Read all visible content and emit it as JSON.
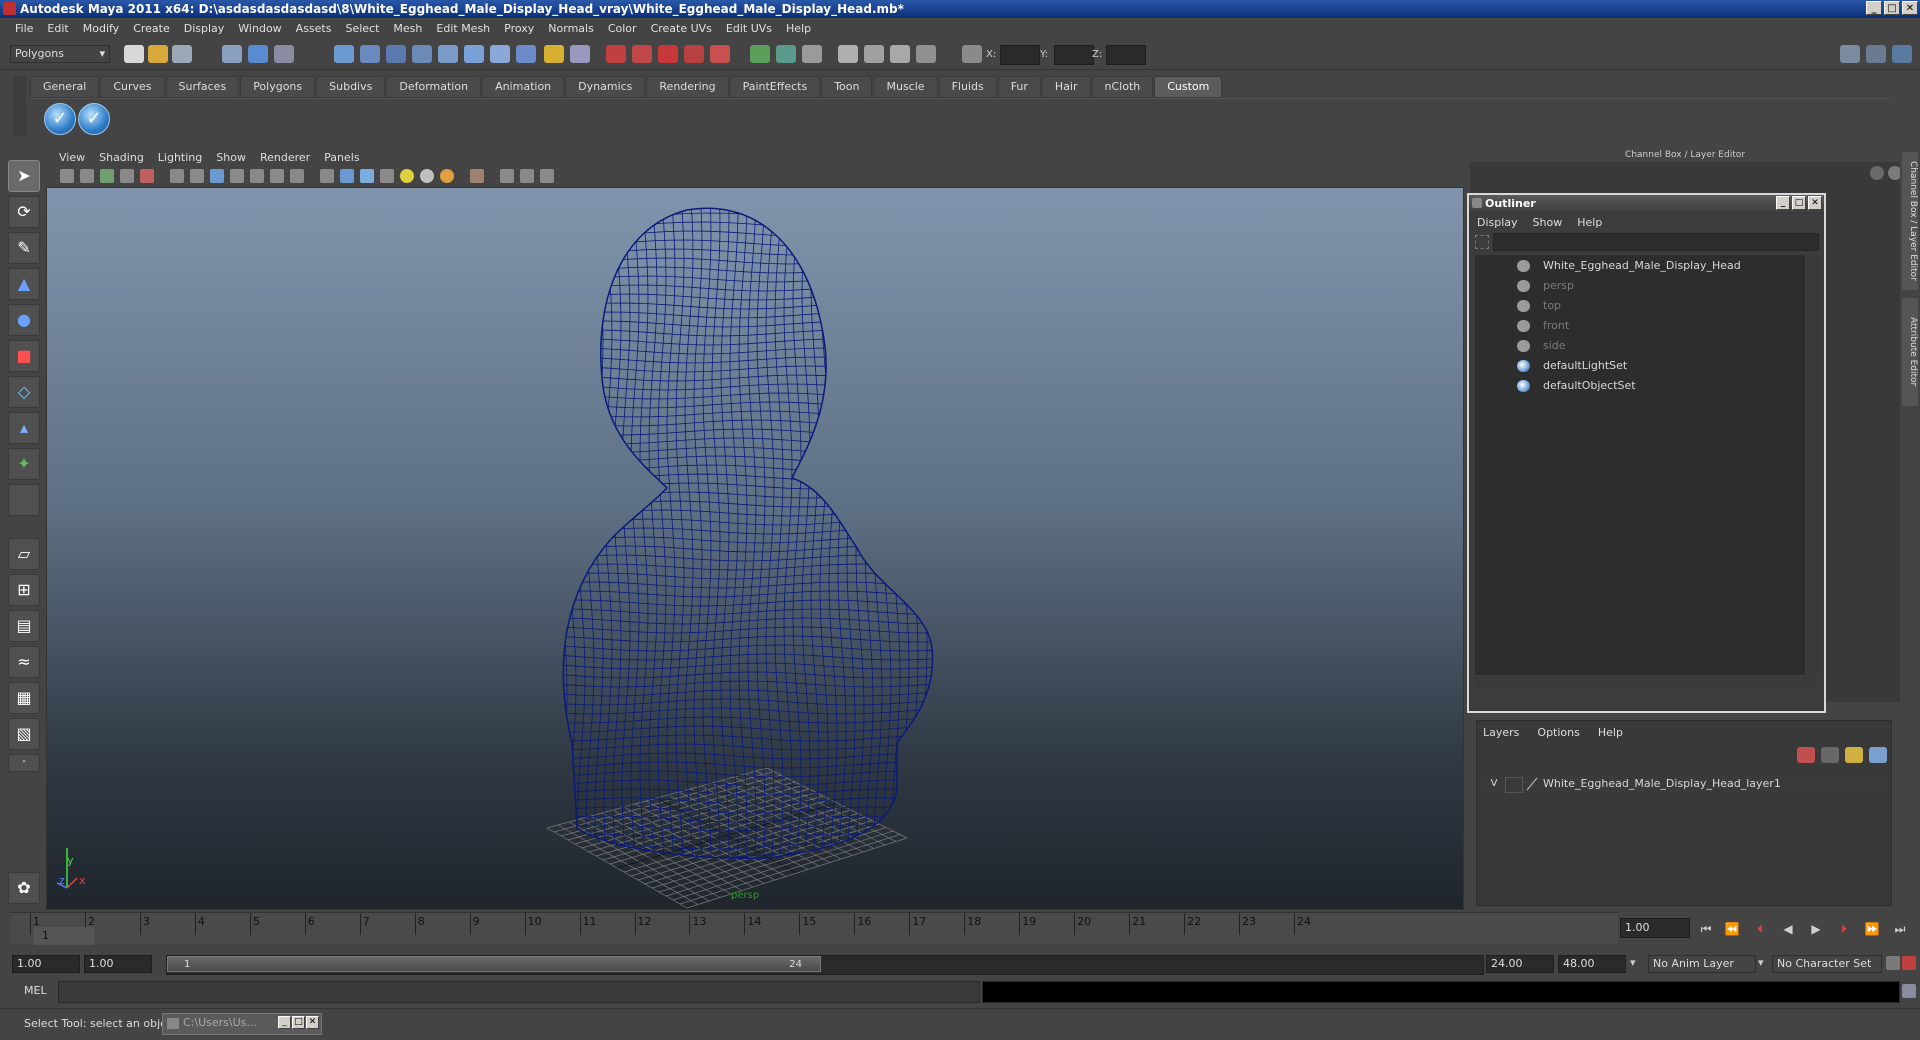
{
  "window": {
    "title": "Autodesk Maya 2011 x64: D:\\asdasdasdasdasd\\8\\White_Egghead_Male_Display_Head_vray\\White_Egghead_Male_Display_Head.mb*",
    "min": "_",
    "max": "□",
    "close": "✕"
  },
  "menubar": [
    "File",
    "Edit",
    "Modify",
    "Create",
    "Display",
    "Window",
    "Assets",
    "Select",
    "Mesh",
    "Edit Mesh",
    "Proxy",
    "Normals",
    "Color",
    "Create UVs",
    "Edit UVs",
    "Help"
  ],
  "statusline": {
    "mode": "Polygons",
    "x_label": "X:",
    "y_label": "Y:",
    "z_label": "Z:"
  },
  "shelf": {
    "tabs": [
      "General",
      "Curves",
      "Surfaces",
      "Polygons",
      "Subdivs",
      "Deformation",
      "Animation",
      "Dynamics",
      "Rendering",
      "PaintEffects",
      "Toon",
      "Muscle",
      "Fluids",
      "Fur",
      "Hair",
      "nCloth",
      "Custom"
    ],
    "active_tab": "Custom"
  },
  "viewport": {
    "menu": [
      "View",
      "Shading",
      "Lighting",
      "Show",
      "Renderer",
      "Panels"
    ],
    "axes": {
      "x": "x",
      "y": "y",
      "z": "z"
    },
    "camera_label": "persp",
    "wire_color": "#0a1a7a"
  },
  "channel_box": {
    "header": "Channel Box / Layer Editor"
  },
  "side_tabs": [
    "Channel Box / Layer Editor",
    "Attribute Editor"
  ],
  "outliner": {
    "title": "Outliner",
    "menu": [
      "Display",
      "Show",
      "Help"
    ],
    "items": [
      {
        "label": "White_Egghead_Male_Display_Head",
        "dim": false,
        "icon": "mesh"
      },
      {
        "label": "persp",
        "dim": true,
        "icon": "camera"
      },
      {
        "label": "top",
        "dim": true,
        "icon": "camera"
      },
      {
        "label": "front",
        "dim": true,
        "icon": "camera"
      },
      {
        "label": "side",
        "dim": true,
        "icon": "camera"
      },
      {
        "label": "defaultLightSet",
        "dim": false,
        "icon": "set"
      },
      {
        "label": "defaultObjectSet",
        "dim": false,
        "icon": "set"
      }
    ]
  },
  "layers": {
    "menu": [
      "Layers",
      "Options",
      "Help"
    ],
    "row": {
      "visible": "V",
      "name": "White_Egghead_Male_Display_Head_layer1"
    }
  },
  "timeline": {
    "frames": [
      1,
      2,
      3,
      4,
      5,
      6,
      7,
      8,
      9,
      10,
      11,
      12,
      13,
      14,
      15,
      16,
      17,
      18,
      19,
      20,
      21,
      22,
      23,
      24
    ],
    "current_frame_display": "1",
    "current_time": "1.00"
  },
  "range": {
    "start_time": "1.00",
    "playback_start": "1.00",
    "slider_start": "1",
    "slider_end": "24",
    "playback_end": "24.00",
    "end_time": "48.00",
    "anim_layer": "No Anim Layer",
    "character_set": "No Character Set"
  },
  "command": {
    "label": "MEL"
  },
  "help": {
    "text": "Select Tool: select an object",
    "taskbar": "C:\\Users\\Us..."
  }
}
